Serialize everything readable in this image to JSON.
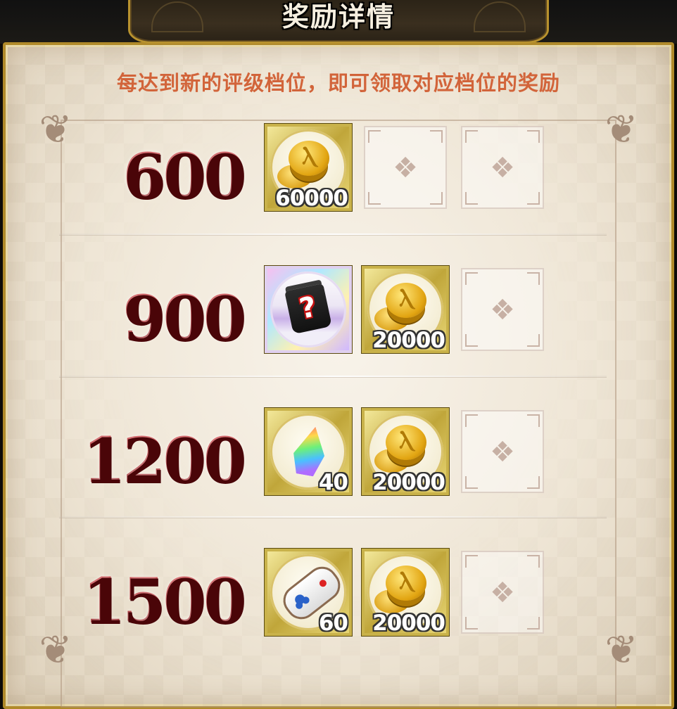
{
  "window": {
    "title": "奖励详情",
    "subtitle": "每达到新的评级档位，即可领取对应档位的奖励"
  },
  "tiers": [
    {
      "score": "600",
      "rewards": [
        {
          "icon": "gold-coin-icon",
          "quantity": "60000"
        },
        {
          "icon": "empty-slot"
        },
        {
          "icon": "empty-slot"
        }
      ]
    },
    {
      "score": "900",
      "rewards": [
        {
          "icon": "mystery-scroll-icon",
          "quantity": ""
        },
        {
          "icon": "gold-coin-icon",
          "quantity": "20000"
        },
        {
          "icon": "empty-slot"
        }
      ]
    },
    {
      "score": "1200",
      "rewards": [
        {
          "icon": "rainbow-crystal-icon",
          "quantity": "40"
        },
        {
          "icon": "gold-coin-icon",
          "quantity": "20000"
        },
        {
          "icon": "empty-slot"
        }
      ]
    },
    {
      "score": "1500",
      "rewards": [
        {
          "icon": "game-controller-icon",
          "quantity": "60"
        },
        {
          "icon": "gold-coin-icon",
          "quantity": "20000"
        },
        {
          "icon": "empty-slot"
        }
      ]
    }
  ],
  "colors": {
    "score_red": "#9c0f14",
    "subtitle_orange": "#d2643a",
    "frame_gold": "#b08a2a"
  }
}
